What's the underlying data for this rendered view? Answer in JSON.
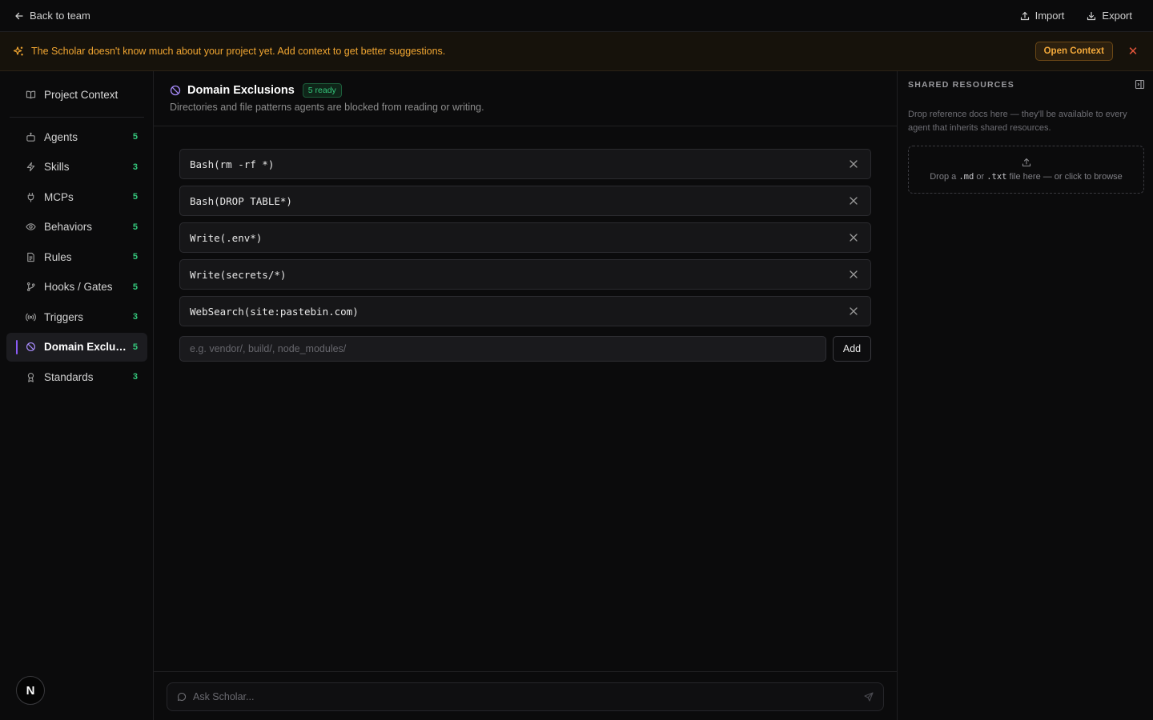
{
  "topbar": {
    "back_label": "Back to team",
    "import_label": "Import",
    "export_label": "Export"
  },
  "banner": {
    "message": "The Scholar doesn't know much about your project yet. Add context to get better suggestions.",
    "action_label": "Open Context",
    "close_symbol": "✕",
    "accent_color": "#f0a531"
  },
  "sidebar": {
    "context_label": "Project Context",
    "items": [
      {
        "label": "Agents",
        "count": "5",
        "icon": "bot-icon"
      },
      {
        "label": "Skills",
        "count": "3",
        "icon": "lightning-icon"
      },
      {
        "label": "MCPs",
        "count": "5",
        "icon": "plug-icon"
      },
      {
        "label": "Behaviors",
        "count": "5",
        "icon": "eye-icon"
      },
      {
        "label": "Rules",
        "count": "5",
        "icon": "document-icon"
      },
      {
        "label": "Hooks / Gates",
        "count": "5",
        "icon": "git-branch-icon"
      },
      {
        "label": "Triggers",
        "count": "3",
        "icon": "radio-waves-icon"
      },
      {
        "label": "Domain Exclusions",
        "count": "5",
        "icon": "ban-icon",
        "active": true
      },
      {
        "label": "Standards",
        "count": "3",
        "icon": "award-icon"
      }
    ],
    "avatar_letter": "N"
  },
  "main": {
    "title": "Domain Exclusions",
    "badge": "5 ready",
    "subtitle": "Directories and file patterns agents are blocked from reading or writing.",
    "rules": [
      "Bash(rm -rf *)",
      "Bash(DROP TABLE*)",
      "Write(.env*)",
      "Write(secrets/*)",
      "WebSearch(site:pastebin.com)"
    ],
    "add_placeholder": "e.g. vendor/, build/, node_modules/",
    "add_label": "Add",
    "ask_placeholder": "Ask Scholar..."
  },
  "resources": {
    "title": "SHARED RESOURCES",
    "description": "Drop reference docs here — they'll be available to every agent that inherits shared resources.",
    "drop_prefix": "Drop a",
    "ext_md": ".md",
    "drop_or": "or",
    "ext_txt": ".txt",
    "drop_suffix": "file here — or click to browse"
  },
  "colors": {
    "accent_purple": "#8b5cf6",
    "count_green": "#34c77b",
    "warning_orange": "#f0a531"
  }
}
